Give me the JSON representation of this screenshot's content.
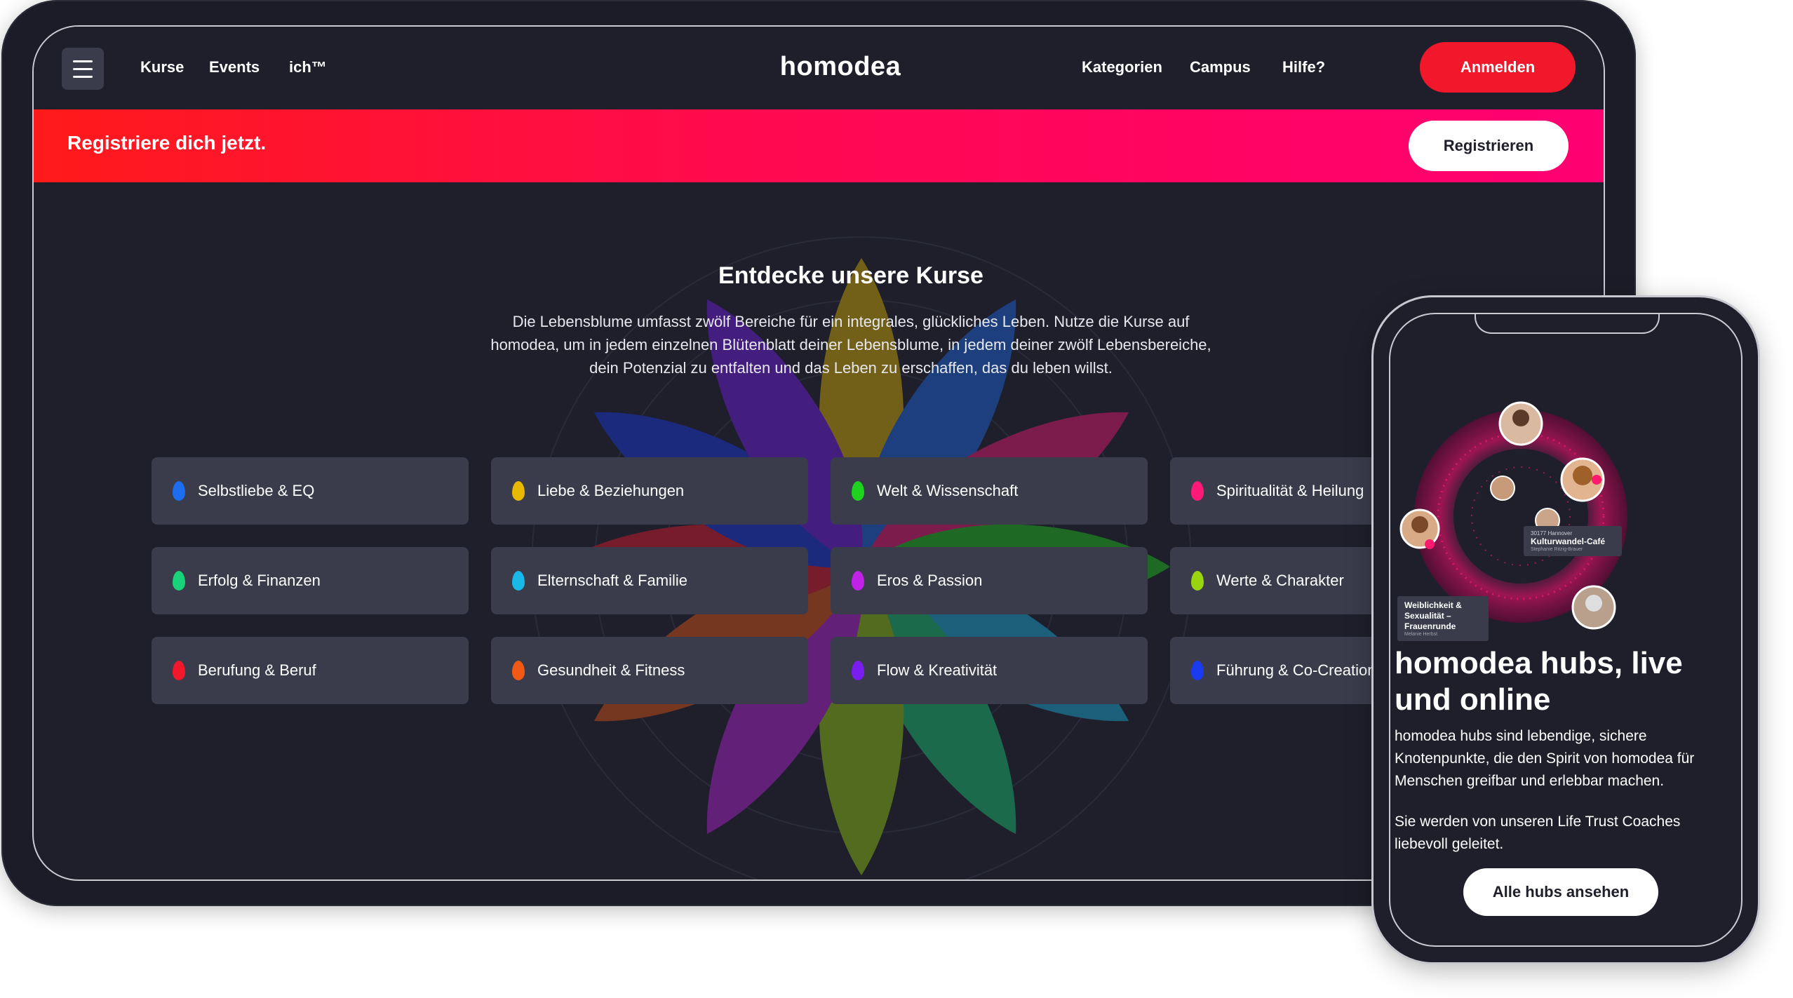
{
  "tablet": {
    "nav": {
      "links_left": [
        "Kurse",
        "Events",
        "ich™"
      ],
      "brand": "homodea",
      "links_right": [
        "Kategorien",
        "Campus",
        "Hilfe?"
      ],
      "login_label": "Anmelden"
    },
    "promo": {
      "text": "Registriere dich jetzt.",
      "button_label": "Registrieren"
    },
    "courses": {
      "title": "Entdecke unsere Kurse",
      "description": "Die Lebensblume umfasst zwölf Bereiche für ein integrales, glückliches Leben. Nutze die Kurse auf homodea, um in jedem einzelnen Blütenblatt deiner Lebensblume, in jedem deiner zwölf Lebensbereiche, dein Potenzial zu entfalten und das Leben zu erschaffen, das du leben willst.",
      "categories": [
        {
          "label": "Selbstliebe & EQ",
          "color": "#1e6cf0"
        },
        {
          "label": "Liebe & Beziehungen",
          "color": "#e6b800"
        },
        {
          "label": "Welt & Wissenschaft",
          "color": "#1fd21f"
        },
        {
          "label": "Spiritualität & Heilung",
          "color": "#ff1a7a"
        },
        {
          "label": "Erfolg & Finanzen",
          "color": "#19d27a"
        },
        {
          "label": "Elternschaft & Familie",
          "color": "#1ab8e8"
        },
        {
          "label": "Eros & Passion",
          "color": "#c023e6"
        },
        {
          "label": "Werte & Charakter",
          "color": "#9ad40f"
        },
        {
          "label": "Berufung & Beruf",
          "color": "#f0182a"
        },
        {
          "label": "Gesundheit & Fitness",
          "color": "#f05a14"
        },
        {
          "label": "Flow & Kreativität",
          "color": "#7a1ef0"
        },
        {
          "label": "Führung & Co-Creation",
          "color": "#1a3af0"
        }
      ]
    }
  },
  "phone": {
    "tags": [
      {
        "line1": "30177 Hannover",
        "line2": "Kulturwandel-Café",
        "line3": "Stephanie Ritzig-Brauer"
      },
      {
        "line1": "",
        "line2": "Weiblichkeit & Sexualität – Frauenrunde",
        "line3": "Melanie Herbst"
      }
    ],
    "title": "homodea hubs, live und online",
    "paragraph1": "homodea hubs sind lebendige, sichere Knotenpunkte, die den Spirit von homodea für Menschen greifbar und erlebbar machen.",
    "paragraph2": "Sie werden von unseren Life Trust Coaches liebevoll geleitet.",
    "button_label": "Alle hubs ansehen"
  }
}
